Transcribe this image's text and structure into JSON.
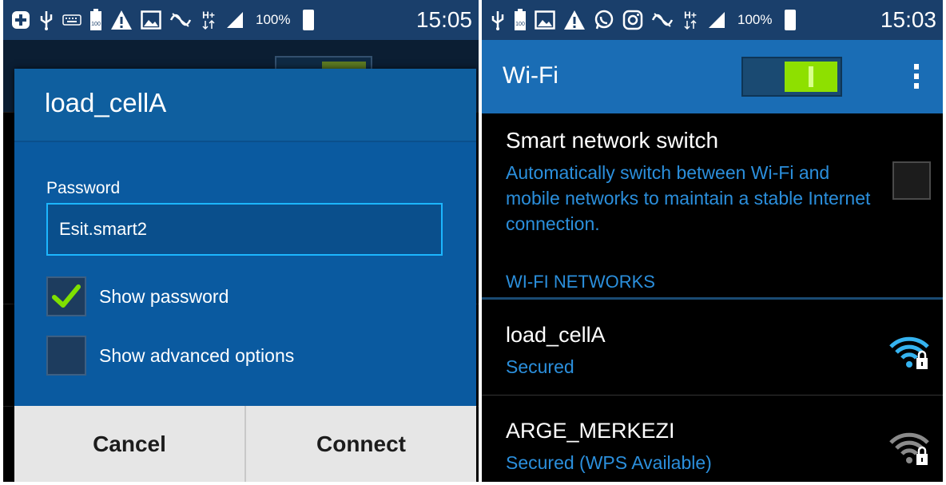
{
  "left_screen": {
    "status_bar": {
      "battery_percent": "100%",
      "time": "15:05"
    },
    "dialog": {
      "title": "load_cellA",
      "password_label": "Password",
      "password_value": "Esit.smart2",
      "show_password": {
        "label": "Show password",
        "checked": true
      },
      "show_advanced": {
        "label": "Show advanced options",
        "checked": false
      },
      "cancel_label": "Cancel",
      "connect_label": "Connect"
    }
  },
  "right_screen": {
    "status_bar": {
      "battery_percent": "100%",
      "time": "15:03"
    },
    "action_bar": {
      "title": "Wi-Fi",
      "wifi_enabled": true
    },
    "smart_network_switch": {
      "title": "Smart network switch",
      "description": "Automatically switch between Wi-Fi and mobile networks to maintain a stable Internet connection.",
      "checked": false
    },
    "networks_header": "WI-FI NETWORKS",
    "networks": [
      {
        "name": "load_cellA",
        "status": "Secured",
        "signal_icon": "wifi-locked-icon",
        "color": "#35b3f0"
      },
      {
        "name": "ARGE_MERKEZI",
        "status": "Secured (WPS Available)",
        "signal_icon": "wifi-locked-icon",
        "color": "#8a8a8a"
      }
    ]
  },
  "colors": {
    "accent": "#1cb6ff",
    "action_bar": "#1a6db5",
    "dialog": "#0a5aa0",
    "toggle_on": "#8ee000"
  }
}
